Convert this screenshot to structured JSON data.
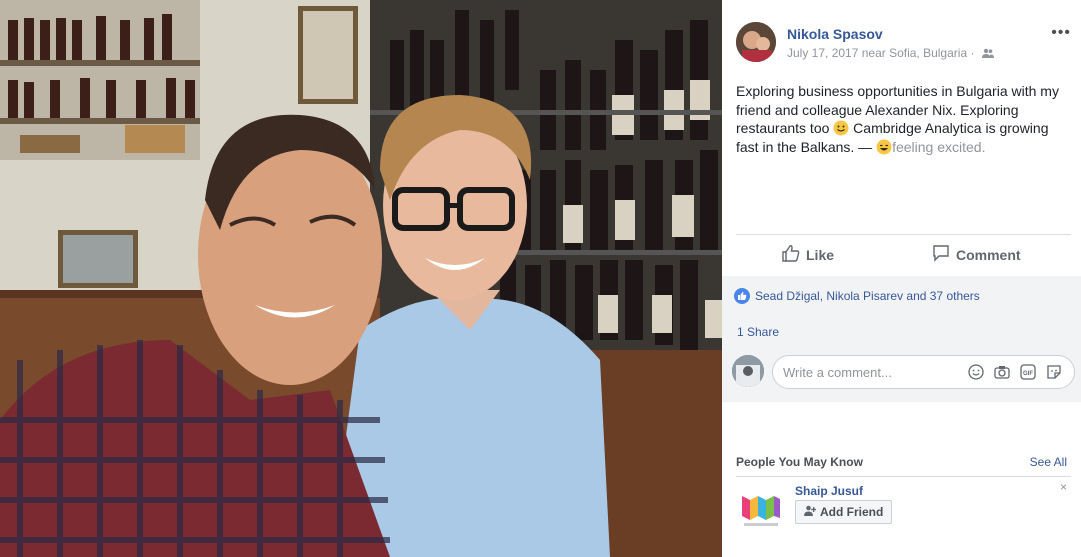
{
  "post": {
    "author": "Nikola Spasov",
    "date": "July 17, 2017 near Sofia, Bulgaria ·",
    "more_label": "•••",
    "text_main": "Exploring business opportunities in Bulgaria with my friend and colleague Alexander Nix. Exploring restaurants too ",
    "text_after_emoji": " Cambridge Analytica is growing fast in the Balkans. — ",
    "feeling": "feeling excited.",
    "audience_icon": "friends-icon"
  },
  "actions": {
    "like_label": "Like",
    "comment_label": "Comment"
  },
  "engagement": {
    "reactions": "Sead Džigal, Nikola Pisarev and 37 others",
    "shares": "1 Share"
  },
  "comment_box": {
    "placeholder": "Write a comment...",
    "tools": [
      "emoji-icon",
      "camera-icon",
      "gif-icon",
      "sticker-icon"
    ]
  },
  "pymk": {
    "title": "People You May Know",
    "see_all": "See All",
    "person_name": "Shaip Jusuf",
    "add_friend": "Add Friend",
    "dismiss": "×"
  },
  "colors": {
    "link": "#365899",
    "text": "#1d2129",
    "muted": "#90949c",
    "panel_bg": "#ffffff",
    "gray_area": "#f2f3f5"
  }
}
